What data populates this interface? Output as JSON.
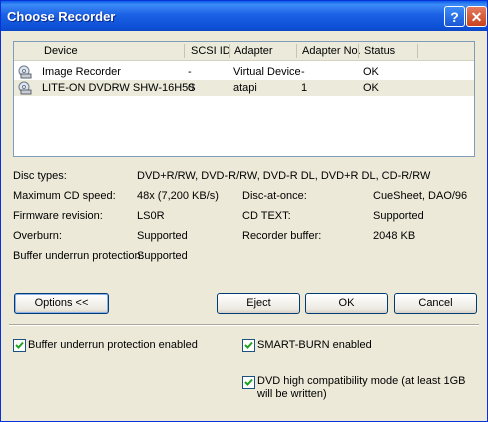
{
  "window": {
    "title": "Choose Recorder",
    "help": "?",
    "close": "✕"
  },
  "columns": [
    "Device",
    "SCSI ID",
    "Adapter",
    "Adapter No.",
    "Status"
  ],
  "rows": [
    {
      "device": "Image Recorder",
      "scsi": "-",
      "adapter": "Virtual Device",
      "adapter_no": "-",
      "status": "OK"
    },
    {
      "device": "LITE-ON  DVDRW SHW-16H5S",
      "scsi": "0",
      "adapter": "atapi",
      "adapter_no": "1",
      "status": "OK"
    }
  ],
  "info": {
    "disc_types_label": "Disc types:",
    "disc_types": "DVD+R/RW, DVD-R/RW, DVD-R DL, DVD+R DL, CD-R/RW",
    "max_cd_label": "Maximum CD speed:",
    "max_cd": "48x (7,200 KB/s)",
    "dao_label": "Disc-at-once:",
    "dao": "CueSheet, DAO/96",
    "fw_label": "Firmware revision:",
    "fw": "LS0R",
    "cdtext_label": "CD TEXT:",
    "cdtext": "Supported",
    "overburn_label": "Overburn:",
    "overburn": "Supported",
    "buffer_label": "Recorder buffer:",
    "buffer": "2048 KB",
    "bup_label": "Buffer underrun protection:",
    "bup": "Supported"
  },
  "buttons": {
    "options": "Options <<",
    "eject": "Eject",
    "ok": "OK",
    "cancel": "Cancel"
  },
  "options": {
    "bup_enabled": "Buffer underrun protection enabled",
    "smartburn": "SMART-BURN enabled",
    "dvd_compat": "DVD high compatibility mode (at least 1GB will be written)"
  }
}
